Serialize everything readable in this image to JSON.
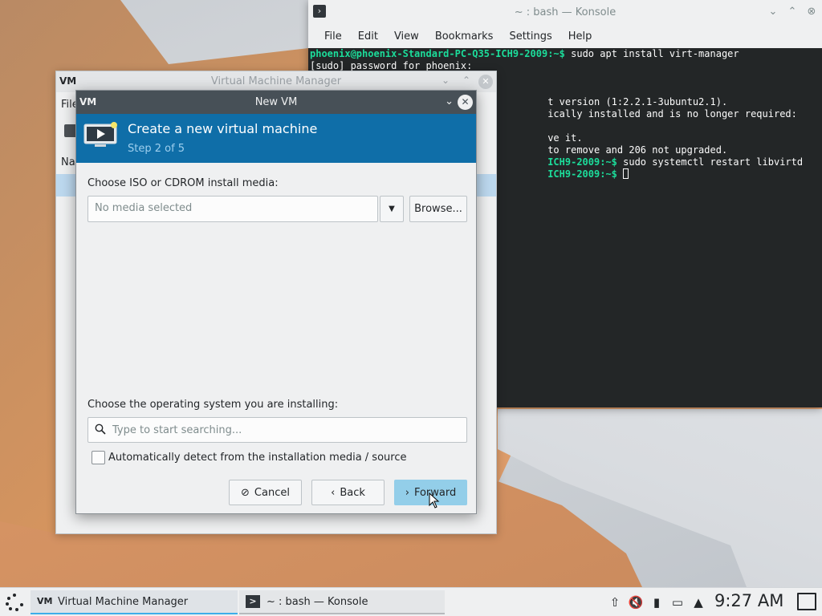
{
  "konsole": {
    "title": "~ : bash — Konsole",
    "menus": [
      "File",
      "Edit",
      "View",
      "Bookmarks",
      "Settings",
      "Help"
    ],
    "lines": [
      {
        "prompt": "phoenix@phoenix-Standard-PC-Q35-ICH9-2009:~$",
        "text": " sudo apt install virt-manager"
      },
      {
        "prompt": "",
        "text": "[sudo] password for phoenix:"
      },
      {
        "prompt": "",
        "text": ""
      },
      {
        "prompt": "",
        "text": ""
      },
      {
        "prompt": "",
        "text": "                                         t version (1:2.2.1-3ubuntu2.1)."
      },
      {
        "prompt": "",
        "text": "                                         ically installed and is no longer required:"
      },
      {
        "prompt": "",
        "text": ""
      },
      {
        "prompt": "",
        "text": "                                         ve it."
      },
      {
        "prompt": "",
        "text": "                                         to remove and 206 not upgraded."
      },
      {
        "prompt": "                                         ICH9-2009:~$",
        "text": " sudo systemctl restart libvirtd"
      },
      {
        "prompt": "                                         ICH9-2009:~$",
        "text": " "
      }
    ]
  },
  "vmm": {
    "logo": "VM",
    "title": "Virtual Machine Manager",
    "menu_partial": "File",
    "column_partial": "Na"
  },
  "dialog": {
    "logo": "VM",
    "title": "New VM",
    "header_title": "Create a new virtual machine",
    "header_step": "Step 2 of 5",
    "media_label": "Choose ISO or CDROM install media:",
    "media_value": "No media selected",
    "browse_label": "Browse...",
    "os_label": "Choose the operating system you are installing:",
    "search_placeholder": "Type to start searching...",
    "autodetect_label": "Automatically detect from the installation media / source",
    "cancel_label": "Cancel",
    "back_label": "Back",
    "forward_label": "Forward"
  },
  "taskbar": {
    "tasks": [
      {
        "icon": "VM",
        "label": "Virtual Machine Manager"
      },
      {
        "icon": ">",
        "label": "~ : bash — Konsole"
      }
    ],
    "clock": "9:27 AM"
  },
  "colors": {
    "dialog_header": "#0f6ea8",
    "dialog_titlebar": "#475057",
    "terminal_bg": "#232627",
    "prompt": "#1cdc9a",
    "primary_button": "#93cee9"
  }
}
